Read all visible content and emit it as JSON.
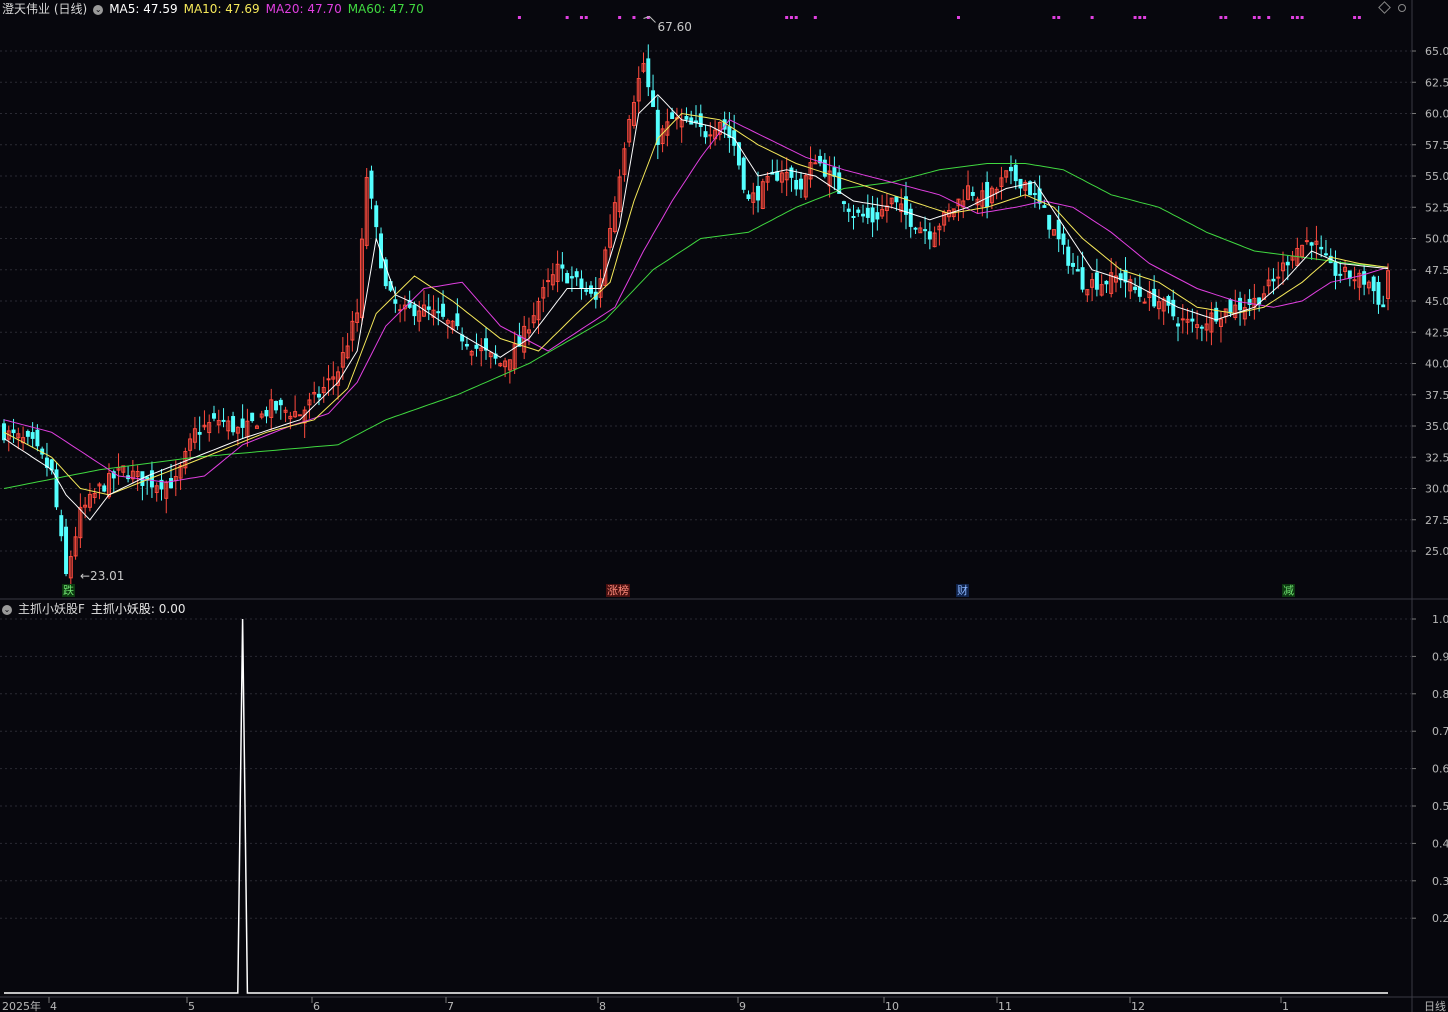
{
  "main_header": {
    "stock": "澄天伟业 (日线)",
    "ma5_label": "MA5: 47.59",
    "ma10_label": "MA10: 47.69",
    "ma20_label": "MA20: 47.70",
    "ma60_label": "MA60: 47.70"
  },
  "indicator_header": {
    "name": "主抓小妖股F",
    "value_label": "主抓小妖股: 0.00"
  },
  "colors": {
    "up": "#ff4b3e",
    "down": "#54ffff",
    "ma5": "#ffffff",
    "ma10": "#f5e85a",
    "ma20": "#e03fe0",
    "ma60": "#40d840",
    "background": "#07070d",
    "signal_dots": "#e040e0"
  },
  "markers": {
    "high_label": "67.60",
    "low_label": "←23.01",
    "event_1": "跌",
    "event_2": "涨榜",
    "event_3": "财",
    "event_4": "减"
  },
  "chart_data": [
    {
      "type": "candlestick",
      "title": "澄天伟业 (日线)",
      "y_axis_ticks": [
        "65.0",
        "62.5",
        "60.0",
        "57.5",
        "55.0",
        "52.5",
        "50.0",
        "47.5",
        "45.0",
        "42.5",
        "40.0",
        "37.5",
        "35.0",
        "32.5",
        "30.0",
        "27.5",
        "25.0"
      ],
      "ylim": [
        21.5,
        67.6
      ],
      "x_axis_ticks": [
        "2025年",
        "4",
        "5",
        "6",
        "7",
        "8",
        "9",
        "10",
        "11",
        "12",
        "1",
        "日线"
      ],
      "highest_price": 67.6,
      "lowest_price": 23.01,
      "latest": {
        "ma5": 47.59,
        "ma10": 47.69,
        "ma20": 47.7,
        "ma60": 47.7
      },
      "series": [
        {
          "name": "MA5",
          "color": "#ffffff"
        },
        {
          "name": "MA10",
          "color": "#f5e85a"
        },
        {
          "name": "MA20",
          "color": "#e03fe0"
        },
        {
          "name": "MA60",
          "color": "#40d840"
        }
      ],
      "close_path": [
        [
          0,
          34.5
        ],
        [
          6,
          33.5
        ],
        [
          10,
          31.2
        ],
        [
          13,
          23.0
        ],
        [
          16,
          28.0
        ],
        [
          20,
          30.0
        ],
        [
          25,
          31.5
        ],
        [
          30,
          30.5
        ],
        [
          36,
          30.5
        ],
        [
          40,
          34.5
        ],
        [
          45,
          35.5
        ],
        [
          50,
          34.5
        ],
        [
          56,
          36.5
        ],
        [
          62,
          36.0
        ],
        [
          66,
          37.5
        ],
        [
          70,
          39.5
        ],
        [
          74,
          44.0
        ],
        [
          76,
          55.0
        ],
        [
          78,
          50.5
        ],
        [
          80,
          46.0
        ],
        [
          83,
          44.0
        ],
        [
          87,
          44.5
        ],
        [
          92,
          43.5
        ],
        [
          98,
          41.5
        ],
        [
          104,
          40.0
        ],
        [
          108,
          41.5
        ],
        [
          112,
          45.0
        ],
        [
          116,
          47.5
        ],
        [
          120,
          46.5
        ],
        [
          124,
          45.0
        ],
        [
          128,
          53.0
        ],
        [
          131,
          60.0
        ],
        [
          134,
          64.0
        ],
        [
          137,
          58.0
        ],
        [
          140,
          59.5
        ],
        [
          144,
          59.0
        ],
        [
          147,
          58.5
        ],
        [
          150,
          59.5
        ],
        [
          153,
          57.5
        ],
        [
          156,
          53.0
        ],
        [
          159,
          54.0
        ],
        [
          163,
          55.5
        ],
        [
          167,
          54.0
        ],
        [
          170,
          56.5
        ],
        [
          174,
          54.5
        ],
        [
          178,
          52.0
        ],
        [
          182,
          51.5
        ],
        [
          186,
          53.0
        ],
        [
          190,
          51.5
        ],
        [
          194,
          50.5
        ],
        [
          198,
          52.0
        ],
        [
          202,
          54.0
        ],
        [
          206,
          53.0
        ],
        [
          210,
          55.0
        ],
        [
          214,
          54.5
        ],
        [
          218,
          52.0
        ],
        [
          222,
          49.0
        ],
        [
          226,
          46.5
        ],
        [
          230,
          46.5
        ],
        [
          234,
          47.0
        ],
        [
          238,
          45.5
        ],
        [
          242,
          45.0
        ],
        [
          246,
          43.5
        ],
        [
          250,
          43.0
        ],
        [
          254,
          44.0
        ],
        [
          258,
          44.5
        ],
        [
          262,
          45.0
        ],
        [
          266,
          46.5
        ],
        [
          270,
          49.0
        ],
        [
          274,
          50.0
        ],
        [
          278,
          47.5
        ],
        [
          282,
          47.0
        ],
        [
          286,
          46.5
        ],
        [
          289,
          44.5
        ],
        [
          290,
          47.5
        ]
      ],
      "ma5_path": [
        [
          0,
          34.0
        ],
        [
          10,
          31.5
        ],
        [
          13,
          29.5
        ],
        [
          18,
          27.5
        ],
        [
          22,
          29.5
        ],
        [
          30,
          31.0
        ],
        [
          40,
          32.5
        ],
        [
          50,
          34.0
        ],
        [
          62,
          35.5
        ],
        [
          70,
          38.5
        ],
        [
          74,
          41.0
        ],
        [
          78,
          50.0
        ],
        [
          82,
          45.5
        ],
        [
          86,
          44.8
        ],
        [
          95,
          42.5
        ],
        [
          104,
          40.5
        ],
        [
          110,
          42.0
        ],
        [
          118,
          46.0
        ],
        [
          125,
          46.0
        ],
        [
          129,
          51.0
        ],
        [
          133,
          60.0
        ],
        [
          137,
          61.5
        ],
        [
          142,
          59.5
        ],
        [
          148,
          59.0
        ],
        [
          153,
          58.0
        ],
        [
          158,
          55.0
        ],
        [
          164,
          55.5
        ],
        [
          170,
          55.0
        ],
        [
          178,
          53.0
        ],
        [
          186,
          52.5
        ],
        [
          194,
          51.5
        ],
        [
          202,
          52.5
        ],
        [
          210,
          54.0
        ],
        [
          216,
          54.5
        ],
        [
          222,
          51.0
        ],
        [
          228,
          47.5
        ],
        [
          236,
          46.5
        ],
        [
          246,
          44.5
        ],
        [
          254,
          43.5
        ],
        [
          262,
          44.5
        ],
        [
          268,
          46.5
        ],
        [
          274,
          49.0
        ],
        [
          280,
          48.0
        ],
        [
          290,
          47.59
        ]
      ],
      "ma10_path": [
        [
          0,
          34.5
        ],
        [
          10,
          32.5
        ],
        [
          16,
          30.0
        ],
        [
          22,
          29.5
        ],
        [
          32,
          31.0
        ],
        [
          42,
          32.5
        ],
        [
          55,
          34.5
        ],
        [
          65,
          35.5
        ],
        [
          72,
          38.0
        ],
        [
          78,
          44.0
        ],
        [
          86,
          47.0
        ],
        [
          94,
          45.0
        ],
        [
          104,
          42.0
        ],
        [
          112,
          41.0
        ],
        [
          120,
          44.0
        ],
        [
          127,
          46.5
        ],
        [
          132,
          53.0
        ],
        [
          137,
          58.0
        ],
        [
          142,
          60.0
        ],
        [
          150,
          59.5
        ],
        [
          158,
          57.5
        ],
        [
          166,
          56.0
        ],
        [
          174,
          55.0
        ],
        [
          182,
          54.0
        ],
        [
          190,
          53.0
        ],
        [
          198,
          52.0
        ],
        [
          206,
          52.5
        ],
        [
          214,
          53.5
        ],
        [
          220,
          52.5
        ],
        [
          226,
          50.0
        ],
        [
          234,
          47.5
        ],
        [
          242,
          46.5
        ],
        [
          250,
          44.5
        ],
        [
          258,
          44.0
        ],
        [
          264,
          44.5
        ],
        [
          272,
          46.5
        ],
        [
          278,
          48.5
        ],
        [
          284,
          48.0
        ],
        [
          290,
          47.69
        ]
      ],
      "ma20_path": [
        [
          0,
          35.5
        ],
        [
          10,
          34.5
        ],
        [
          16,
          33.0
        ],
        [
          24,
          31.0
        ],
        [
          34,
          30.5
        ],
        [
          42,
          31.0
        ],
        [
          50,
          33.5
        ],
        [
          60,
          35.0
        ],
        [
          68,
          36.0
        ],
        [
          74,
          38.5
        ],
        [
          80,
          43.0
        ],
        [
          88,
          46.0
        ],
        [
          96,
          46.5
        ],
        [
          104,
          43.0
        ],
        [
          114,
          41.0
        ],
        [
          122,
          43.0
        ],
        [
          128,
          44.5
        ],
        [
          134,
          49.0
        ],
        [
          140,
          53.0
        ],
        [
          146,
          56.5
        ],
        [
          152,
          59.5
        ],
        [
          160,
          58.0
        ],
        [
          168,
          56.5
        ],
        [
          176,
          55.5
        ],
        [
          186,
          54.5
        ],
        [
          196,
          53.5
        ],
        [
          204,
          52.0
        ],
        [
          212,
          52.5
        ],
        [
          218,
          53.0
        ],
        [
          224,
          52.5
        ],
        [
          232,
          50.5
        ],
        [
          240,
          48.0
        ],
        [
          250,
          46.0
        ],
        [
          258,
          45.0
        ],
        [
          266,
          44.5
        ],
        [
          272,
          45.0
        ],
        [
          278,
          46.5
        ],
        [
          284,
          47.0
        ],
        [
          290,
          47.7
        ]
      ],
      "ma60_path": [
        [
          0,
          30.0
        ],
        [
          20,
          31.5
        ],
        [
          40,
          32.5
        ],
        [
          55,
          33.0
        ],
        [
          70,
          33.5
        ],
        [
          80,
          35.5
        ],
        [
          95,
          37.5
        ],
        [
          110,
          40.0
        ],
        [
          126,
          43.5
        ],
        [
          136,
          47.5
        ],
        [
          146,
          50.0
        ],
        [
          156,
          50.5
        ],
        [
          166,
          52.5
        ],
        [
          176,
          54.0
        ],
        [
          186,
          54.5
        ],
        [
          196,
          55.5
        ],
        [
          206,
          56.0
        ],
        [
          214,
          56.0
        ],
        [
          222,
          55.5
        ],
        [
          232,
          53.5
        ],
        [
          242,
          52.5
        ],
        [
          252,
          50.5
        ],
        [
          262,
          49.0
        ],
        [
          272,
          48.5
        ],
        [
          282,
          48.0
        ],
        [
          290,
          47.7
        ]
      ],
      "signal_days": [
        108,
        118,
        121,
        122,
        129,
        132,
        135,
        164,
        165,
        166,
        170,
        200,
        220,
        221,
        228,
        237,
        238,
        239,
        255,
        256,
        262,
        263,
        265,
        270,
        271,
        272,
        283,
        284
      ]
    },
    {
      "type": "line",
      "title": "主抓小妖股F",
      "series": [
        {
          "name": "主抓小妖股",
          "color": "#ffffff"
        }
      ],
      "y_axis_ticks": [
        "1.0",
        "0.9",
        "0.8",
        "0.7",
        "0.6",
        "0.5",
        "0.4",
        "0.3",
        "0.2"
      ],
      "ylim": [
        0,
        1.0
      ],
      "x": [
        0,
        49,
        50,
        51,
        290
      ],
      "y": [
        0,
        0,
        1.0,
        0,
        0
      ],
      "current_value": 0.0
    }
  ]
}
